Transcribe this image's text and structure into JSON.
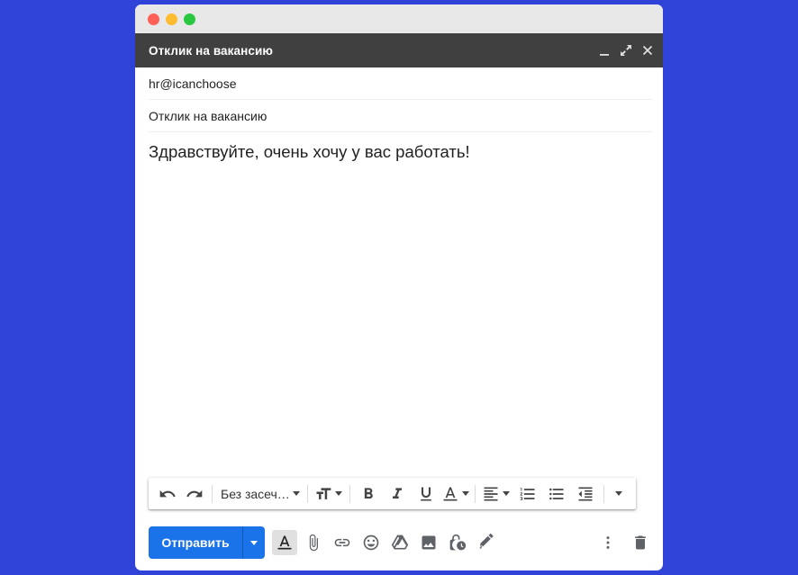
{
  "window": {
    "header_title": "Отклик на вакансию"
  },
  "compose": {
    "to": "hr@icanchoose",
    "subject": "Отклик на вакансию",
    "body": "Здравствуйте, очень хочу у вас работать!"
  },
  "toolbar": {
    "font_family": "Без засеч…"
  },
  "bottom": {
    "send_label": "Отправить"
  },
  "colors": {
    "background": "#3043d9",
    "header": "#404040",
    "send": "#1a73e8"
  }
}
